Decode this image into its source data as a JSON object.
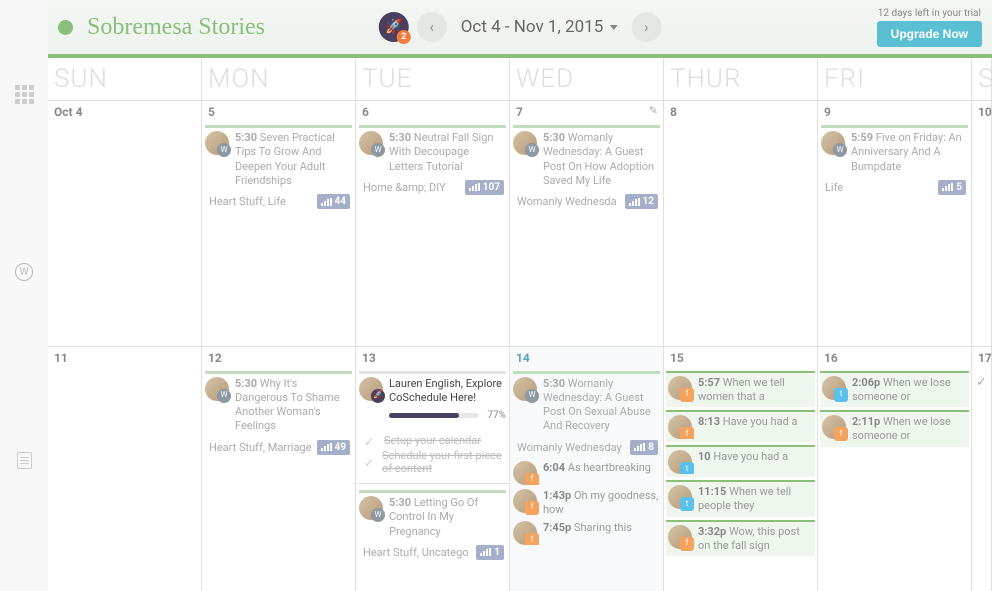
{
  "header": {
    "brand": "Sobremesa Stories",
    "rocket_badge": "2",
    "prev_glyph": "‹",
    "next_glyph": "›",
    "date_range": "Oct 4 - Nov 1, 2015",
    "trial_text": "12 days left in your trial",
    "upgrade_label": "Upgrade Now"
  },
  "weekdays": [
    "SUN",
    "MON",
    "TUE",
    "WED",
    "THUR",
    "FRI",
    "S"
  ],
  "dates": {
    "r1": [
      "Oct 4",
      "5",
      "6",
      "7",
      "8",
      "9",
      "10"
    ],
    "r2": [
      "11",
      "12",
      "13",
      "14",
      "15",
      "16",
      "17"
    ]
  },
  "row1": {
    "mon": {
      "time": "5:30",
      "title": "Seven Practical Tips To Grow And Deepen Your Adult Friendships",
      "meta": "Heart Stuff, Life",
      "stat": "44"
    },
    "tue": {
      "time": "5:30",
      "title": "Neutral Fall Sign With Decoupage Letters Tutorial",
      "meta": "Home &amp; DIY",
      "stat": "107"
    },
    "wed": {
      "time": "5:30",
      "title": "Womanly Wednesday: A Guest Post On How Adoption Saved My Life",
      "meta": "Womanly Wednesda",
      "stat": "12"
    },
    "fri": {
      "time": "5:59",
      "title": "Five on Friday: An Anniversary And A Bumpdate",
      "meta": "Life",
      "stat": "5"
    }
  },
  "row2": {
    "mon": {
      "time": "5:30",
      "title": "Why It's Dangerous To Shame Another Woman's Feelings",
      "meta": "Heart Stuff, Marriage",
      "stat": "49"
    },
    "tue_top": {
      "title": "Lauren English, Explore CoSchedule Here!",
      "percent": "77%",
      "task1": "Setup your calendar",
      "task2": "Schedule your first piece of content"
    },
    "tue_bot": {
      "time": "5:30",
      "title": "Letting Go Of Control In My Pregnancy",
      "meta": "Heart Stuff, Uncatego",
      "stat": "1"
    },
    "wed": {
      "p1": {
        "time": "5:30",
        "title": "Womanly Wednesday: A Guest Post On Sexual Abuse And Recovery"
      },
      "p1_meta": "Womanly Wednesday",
      "p1_stat": "8",
      "s1": {
        "time": "6:04",
        "text": "As heartbreaking"
      },
      "s2": {
        "time": "1:43p",
        "text": "Oh my goodness, how"
      },
      "s3": {
        "time": "7:45p",
        "text": "Sharing this"
      }
    },
    "thur": {
      "s1": {
        "time": "5:57",
        "text": "When we tell women that a"
      },
      "s2": {
        "time": "8:13",
        "text": "Have you had a"
      },
      "s3": {
        "time": "10",
        "text": "Have you had a"
      },
      "s4": {
        "time": "11:15",
        "text": "When we tell people they"
      },
      "s5": {
        "time": "3:32p",
        "text": "Wow, this post on the fall sign"
      }
    },
    "fri": {
      "s1": {
        "time": "2:06p",
        "text": "When we lose someone or"
      },
      "s2": {
        "time": "2:11p",
        "text": "When we lose someone or"
      }
    }
  }
}
